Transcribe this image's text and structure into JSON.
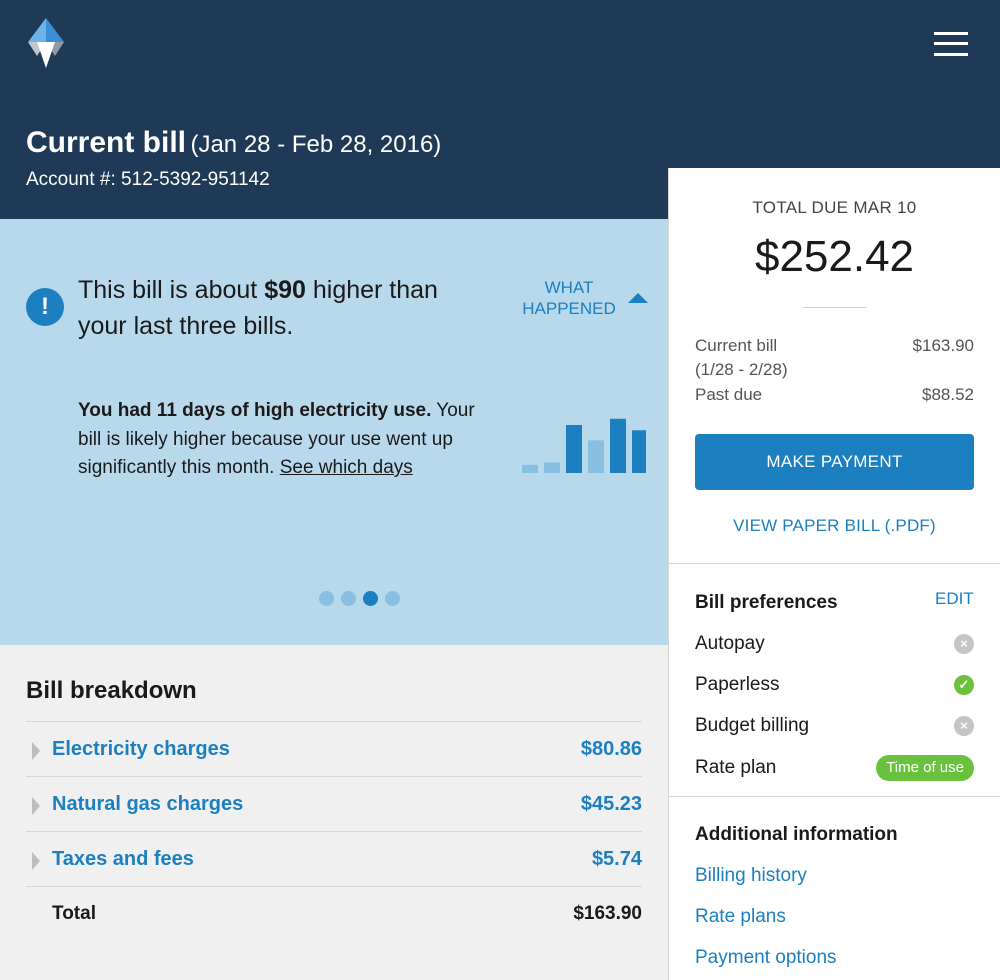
{
  "header": {
    "title": "Current bill",
    "date_range": "(Jan 28 - Feb 28, 2016)",
    "account": "Account #: 512-5392-951142"
  },
  "alert": {
    "text_pre": "This bill is about ",
    "amount": "$90",
    "text_post": " higher than your last three bills.",
    "what_happened_line1": "WHAT",
    "what_happened_line2": "HAPPENED",
    "detail_headline": "You had 11 days of high electricity use.",
    "detail_body": " Your bill is likely higher because your use went up significantly this month. ",
    "detail_link": "See which days",
    "carousel": {
      "count": 4,
      "active_index": 2
    },
    "mini_chart": {
      "relative_values": [
        0.17,
        0.22,
        1.0,
        0.68,
        1.13,
        0.89
      ],
      "highlighted": [
        false,
        false,
        true,
        false,
        true,
        true
      ],
      "colors": {
        "normal": "#89bfe0",
        "high": "#1b7fc0"
      }
    }
  },
  "breakdown": {
    "title": "Bill breakdown",
    "rows": [
      {
        "label": "Electricity charges",
        "amount": "$80.86"
      },
      {
        "label": "Natural gas charges",
        "amount": "$45.23"
      },
      {
        "label": "Taxes and fees",
        "amount": "$5.74"
      }
    ],
    "total_label": "Total",
    "total_amount": "$163.90"
  },
  "summary": {
    "due_label": "TOTAL DUE MAR 10",
    "due_amount": "$252.42",
    "current_bill_label": "Current bill",
    "current_bill_range": "(1/28 - 2/28)",
    "current_bill_amount": "$163.90",
    "past_due_label": "Past due",
    "past_due_amount": "$88.52",
    "pay_button": "MAKE PAYMENT",
    "paper_bill_link": "VIEW PAPER BILL (.PDF)"
  },
  "preferences": {
    "title": "Bill preferences",
    "edit": "EDIT",
    "items": [
      {
        "label": "Autopay",
        "status": "off",
        "icon": "x-circle-icon"
      },
      {
        "label": "Paperless",
        "status": "on",
        "icon": "check-circle-icon"
      },
      {
        "label": "Budget billing",
        "status": "off",
        "icon": "x-circle-icon"
      }
    ],
    "rate_plan_label": "Rate plan",
    "rate_plan_value": "Time of use"
  },
  "additional": {
    "title": "Additional information",
    "links": [
      "Billing history",
      "Rate plans",
      "Payment options"
    ]
  },
  "colors": {
    "header_bg": "#1e3a56",
    "accent": "#1b7fc0",
    "alert_bg": "#b8d9eb",
    "success": "#6ac13e"
  }
}
